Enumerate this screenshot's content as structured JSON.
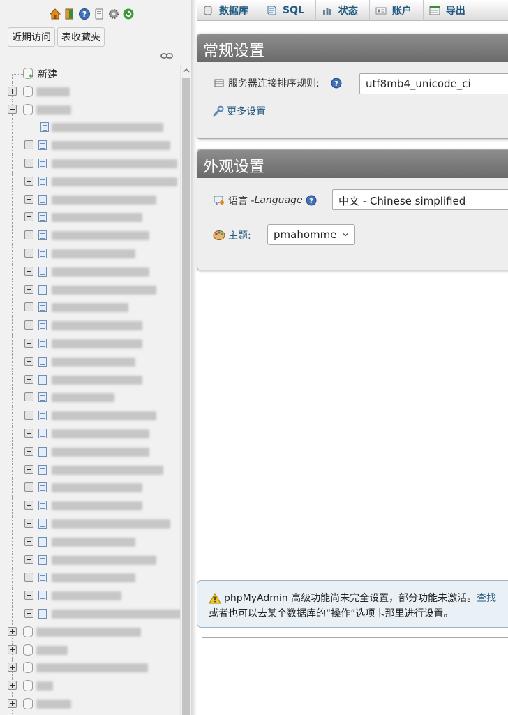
{
  "nav": {
    "icons": [
      "home-icon",
      "exit-icon",
      "help-icon",
      "docs-icon",
      "settings-icon",
      "reload-icon"
    ],
    "tabs": {
      "recent": "近期访问",
      "favorites": "表收藏夹"
    },
    "tree": {
      "new_label": "新建"
    }
  },
  "topmenu": {
    "items": [
      {
        "label": "数据库",
        "icon": "database-icon"
      },
      {
        "label": "SQL",
        "icon": "sql-icon"
      },
      {
        "label": "状态",
        "icon": "status-icon"
      },
      {
        "label": "账户",
        "icon": "accounts-icon"
      },
      {
        "label": "导出",
        "icon": "export-icon"
      }
    ]
  },
  "general_settings": {
    "title": "常规设置",
    "collation_label": "服务器连接排序规则:",
    "collation_value": "utf8mb4_unicode_ci",
    "more_settings": "更多设置"
  },
  "appearance_settings": {
    "title": "外观设置",
    "language_label": "语言 - ",
    "language_label_en": "Language",
    "language_value": "中文 - Chinese simplified",
    "theme_label": "主题:",
    "theme_value": "pmahomme"
  },
  "notice": {
    "line1": "phpMyAdmin 高级功能尚未完全设置，部分功能未激活。",
    "link": "查找",
    "line2": "或者也可以去某个数据库的“操作”选项卡那里进行设置。"
  },
  "colors": {
    "accent": "#235a81",
    "panel_title_bg": "#7a7a7a",
    "notice_bg": "#e9f0f6"
  }
}
